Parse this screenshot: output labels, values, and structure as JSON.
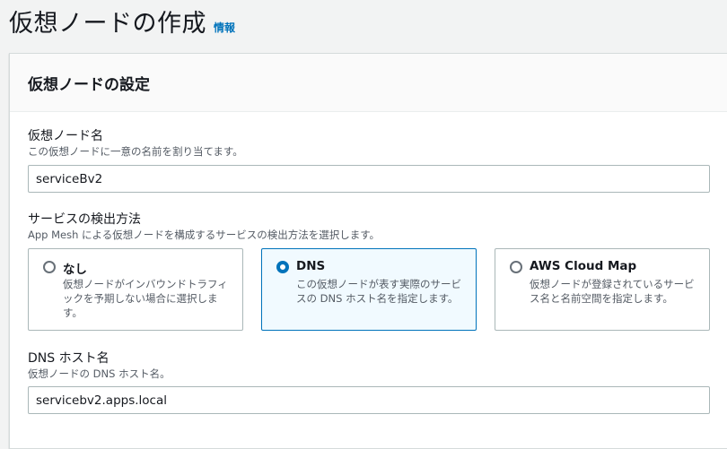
{
  "page": {
    "title": "仮想ノードの作成",
    "info_link": "情報"
  },
  "panel": {
    "header": "仮想ノードの設定",
    "node_name": {
      "label": "仮想ノード名",
      "description": "この仮想ノードに一意の名前を割り当てます。",
      "value": "serviceBv2"
    },
    "discovery": {
      "label": "サービスの検出方法",
      "description": "App Mesh による仮想ノードを構成するサービスの検出方法を選択します。",
      "options": [
        {
          "title": "なし",
          "description": "仮想ノードがインバウンドトラフィックを予期しない場合に選択します。",
          "selected": false
        },
        {
          "title": "DNS",
          "description": "この仮想ノードが表す実際のサービスの DNS ホスト名を指定します。",
          "selected": true
        },
        {
          "title": "AWS Cloud Map",
          "description": "仮想ノードが登録されているサービス名と名前空間を指定します。",
          "selected": false
        }
      ]
    },
    "dns_hostname": {
      "label": "DNS ホスト名",
      "description": "仮想ノードの DNS ホスト名。",
      "value": "servicebv2.apps.local"
    }
  },
  "colors": {
    "accent": "#0073bb",
    "selected_tile_bg": "#f1faff",
    "page_bg": "#f2f3f3"
  }
}
